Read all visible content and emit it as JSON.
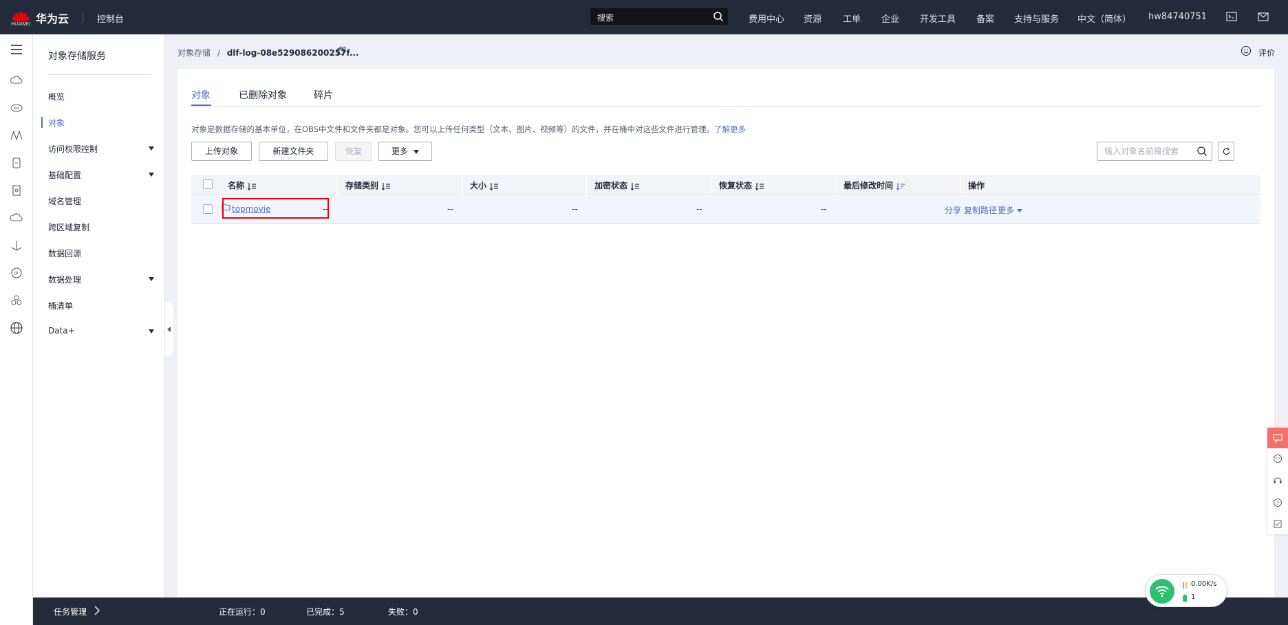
{
  "header": {
    "brand_name": "华为云",
    "brand_sub": "HUAWEI",
    "console": "控制台",
    "search_placeholder": "搜索",
    "nav": [
      "费用中心",
      "资源",
      "工单",
      "企业",
      "开发工具",
      "备案",
      "支持与服务",
      "中文（简体）",
      "hw84740751"
    ]
  },
  "sidebar": {
    "title": "对象存储服务",
    "items": [
      {
        "label": "概览"
      },
      {
        "label": "对象"
      },
      {
        "label": "访问权限控制"
      },
      {
        "label": "基础配置"
      },
      {
        "label": "域名管理"
      },
      {
        "label": "跨区域复制"
      },
      {
        "label": "数据回源"
      },
      {
        "label": "数据处理"
      },
      {
        "label": "桶清单"
      },
      {
        "label": "Data+"
      }
    ]
  },
  "breadcrumb": {
    "root": "对象存储",
    "sep": "/",
    "current": "dlf-log-08e529086200257f..."
  },
  "feedback_label": "评价",
  "tabs": [
    "对象",
    "已删除对象",
    "碎片"
  ],
  "description": {
    "text": "对象是数据存储的基本单位，在OBS中文件和文件夹都是对象。您可以上传任何类型（文本、图片、视频等）的文件，并在桶中对这些文件进行管理。",
    "link": "了解更多"
  },
  "toolbar": {
    "upload": "上传对象",
    "new_folder": "新建文件夹",
    "restore": "恢复",
    "more": "更多",
    "search_placeholder": "输入对象名前缀搜索"
  },
  "table": {
    "columns": [
      "名称",
      "存储类别",
      "大小",
      "加密状态",
      "恢复状态",
      "最后修改时间",
      "操作"
    ],
    "rows": [
      {
        "name": "topmovie",
        "storage_class": "--",
        "size": "--",
        "encryption": "--",
        "restore": "--",
        "modified": "--",
        "ops": [
          "分享",
          "复制路径",
          "更多"
        ]
      }
    ]
  },
  "taskbar": {
    "title": "任务管理",
    "running_label": "正在运行：",
    "running": "0",
    "done_label": "已完成：",
    "done": "5",
    "failed_label": "失败：",
    "failed": "0"
  },
  "network": {
    "speed": "0.00K/s",
    "count": "1"
  },
  "colors": {
    "topbar": "#252b3a",
    "accent": "#526ecc",
    "highlight": "#e60012",
    "float_top": "#f66f6a",
    "wifi": "#2fbf71"
  }
}
